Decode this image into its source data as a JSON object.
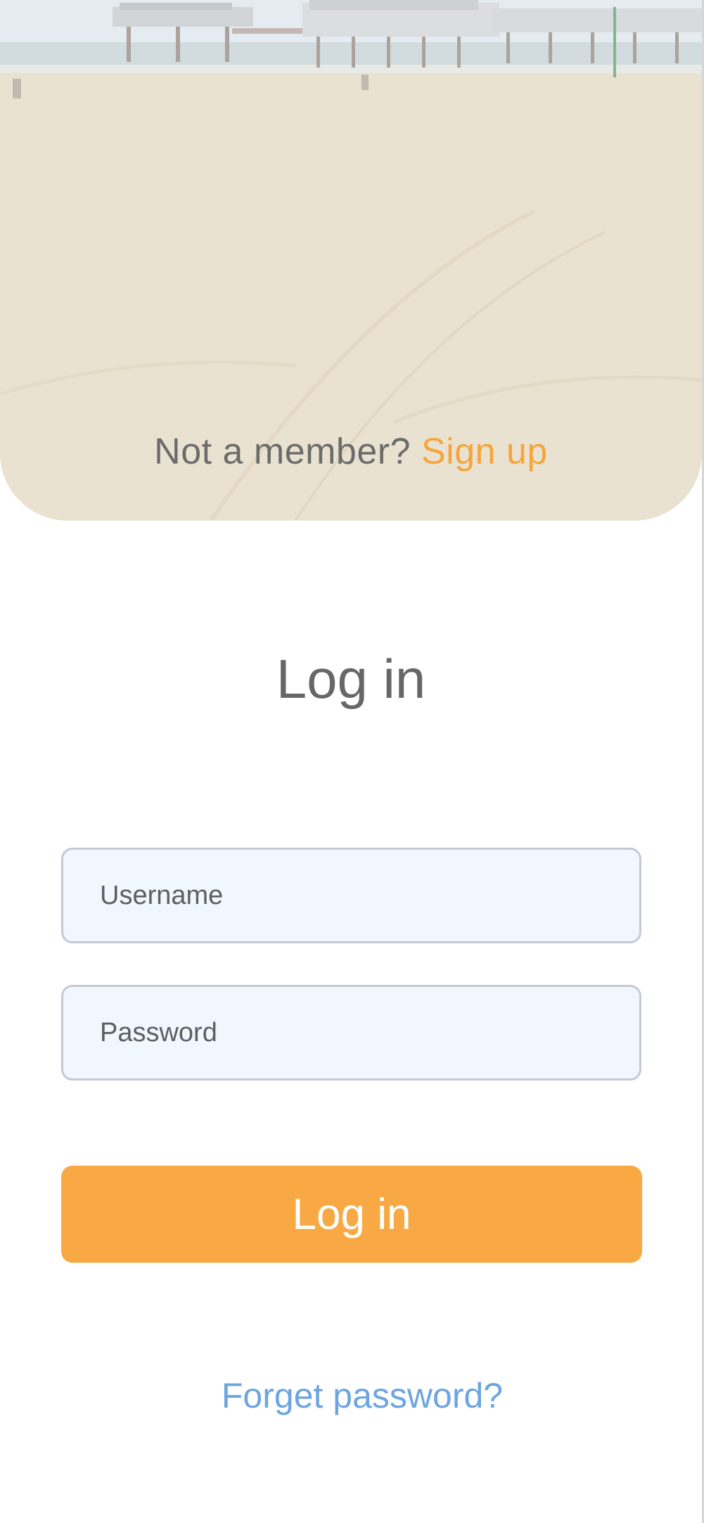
{
  "hero": {
    "prompt_text": "Not a member?",
    "signup_link": "Sign up"
  },
  "form": {
    "title": "Log in",
    "username_placeholder": "Username",
    "password_placeholder": "Password",
    "submit_label": "Log in",
    "forgot_link": "Forget password?"
  },
  "colors": {
    "accent": "#f9a944",
    "signup_link": "#f6a53c",
    "forgot_link": "#6ca5e0",
    "field_background": "#f0f7ff",
    "field_border": "#c3cad6"
  }
}
